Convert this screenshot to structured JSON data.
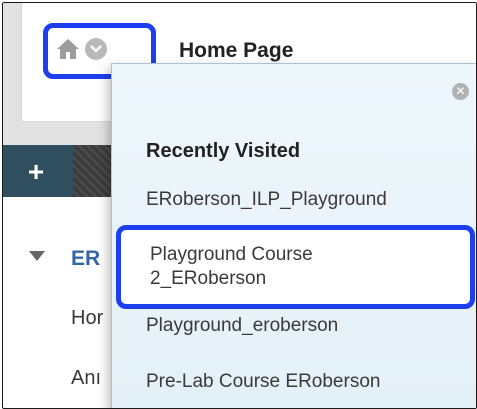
{
  "header": {
    "page_title": "Home Page"
  },
  "icons": {
    "home": "home-icon",
    "menu": "chevron-down-circle-icon",
    "close": "close-circle-icon",
    "add": "plus-icon",
    "tree": "triangle-down-icon"
  },
  "left_nav": {
    "add_label": "+",
    "course_short": "ER",
    "links": [
      "Hor",
      "Anı"
    ]
  },
  "dropdown": {
    "heading": "Recently Visited",
    "items": [
      {
        "label": "ERoberson_ILP_Playground"
      },
      {
        "label_line1": "Playground Course",
        "label_line2": "2_ERoberson"
      },
      {
        "label": "Playground_eroberson"
      },
      {
        "label": "Pre-Lab Course ERoberson"
      }
    ]
  },
  "colors": {
    "highlight": "#1e3ff0",
    "nav_bar": "#2f4f5f",
    "course_link": "#3465a4"
  }
}
